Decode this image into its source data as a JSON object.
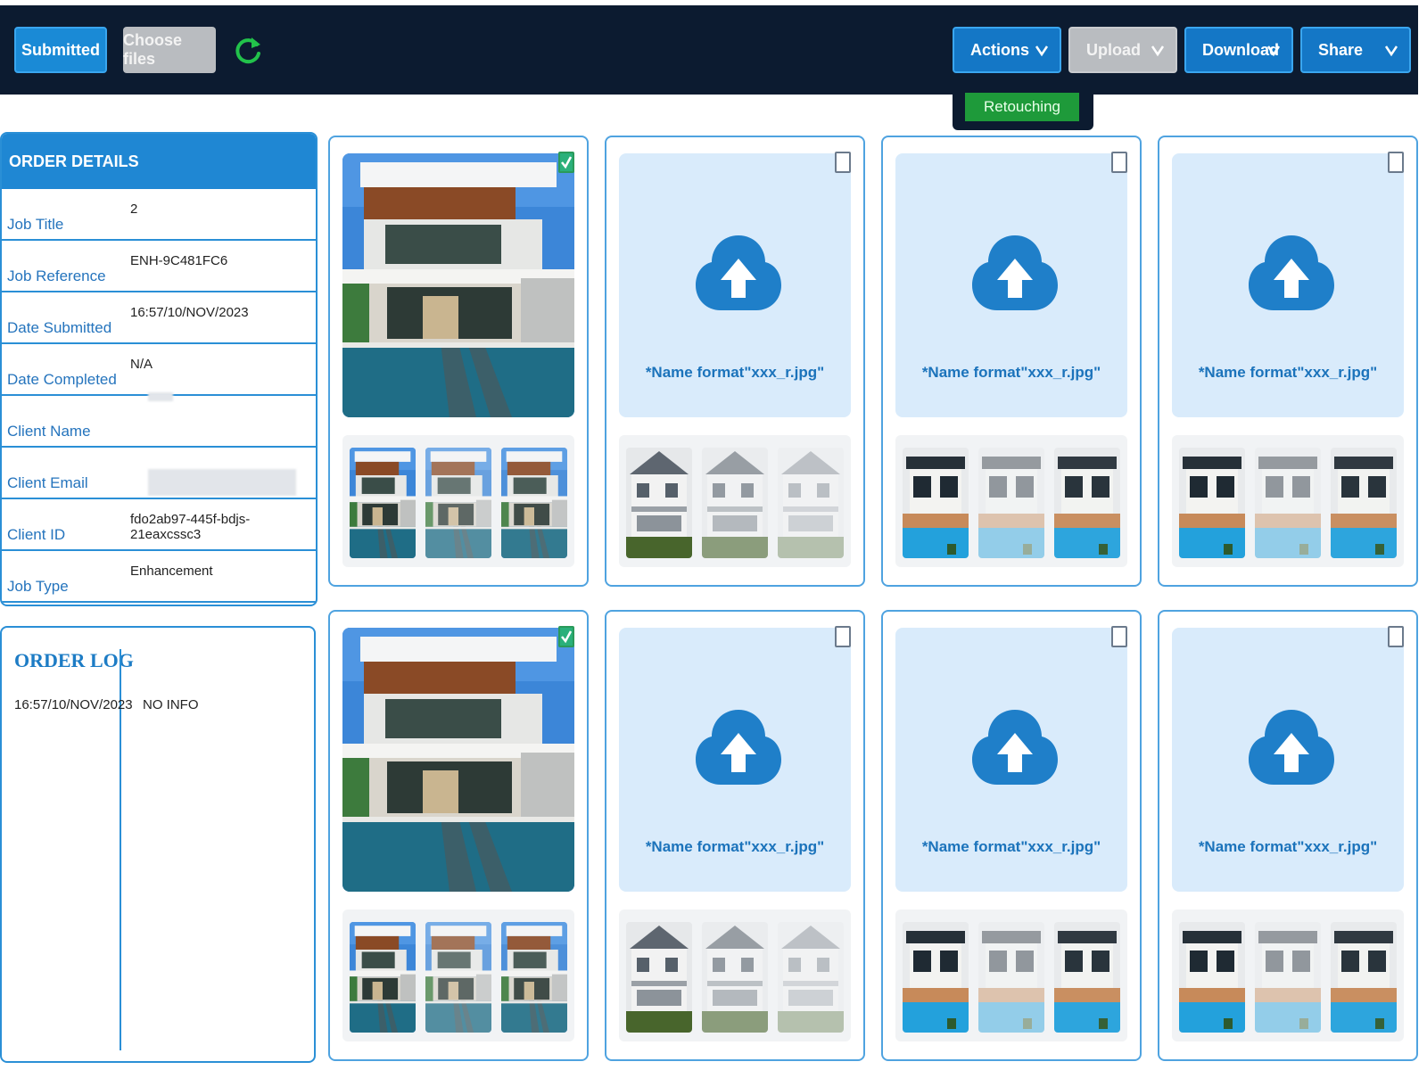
{
  "toolbar": {
    "submitted_label": "Submitted",
    "choose_files_label": "Choose files",
    "refresh_icon": "refresh-icon",
    "actions_label": "Actions",
    "upload_label": "Upload",
    "download_label": "Download",
    "share_label": "Share",
    "actions_menu": {
      "item": "Retouching"
    }
  },
  "order_details": {
    "title": "ORDER DETAILS",
    "rows": [
      {
        "label": "Job Title",
        "value": "2"
      },
      {
        "label": "Job Reference",
        "value": "ENH-9C481FC6"
      },
      {
        "label": "Date Submitted",
        "value": "16:57/10/NOV/2023"
      },
      {
        "label": "Date Completed",
        "value": "N/A"
      },
      {
        "label": "Client Name",
        "value": ""
      },
      {
        "label": "Client Email",
        "value": ""
      },
      {
        "label": "Client ID",
        "value": "fdo2ab97-445f-bdjs-21eaxcssc3"
      },
      {
        "label": "Job Type",
        "value": "Enhancement"
      }
    ]
  },
  "order_log": {
    "title": "ORDER LOG",
    "entries": [
      {
        "time": "16:57/10/NOV/2023",
        "info": "NO INFO"
      }
    ]
  },
  "cards": [
    {
      "type": "photo",
      "checked": true
    },
    {
      "type": "upload",
      "hint": "*Name format\"xxx_r.jpg\"",
      "checked": false
    },
    {
      "type": "upload",
      "hint": "*Name format\"xxx_r.jpg\"",
      "checked": false
    },
    {
      "type": "upload",
      "hint": "*Name format\"xxx_r.jpg\"",
      "checked": false
    },
    {
      "type": "photo",
      "checked": true
    },
    {
      "type": "upload",
      "hint": "*Name format\"xxx_r.jpg\"",
      "checked": false
    },
    {
      "type": "upload",
      "hint": "*Name format\"xxx_r.jpg\"",
      "checked": false
    },
    {
      "type": "upload",
      "hint": "*Name format\"xxx_r.jpg\"",
      "checked": false
    }
  ],
  "colors": {
    "accent": "#1477c6",
    "navbar": "#0c1b30",
    "success": "#1e9a3a"
  }
}
